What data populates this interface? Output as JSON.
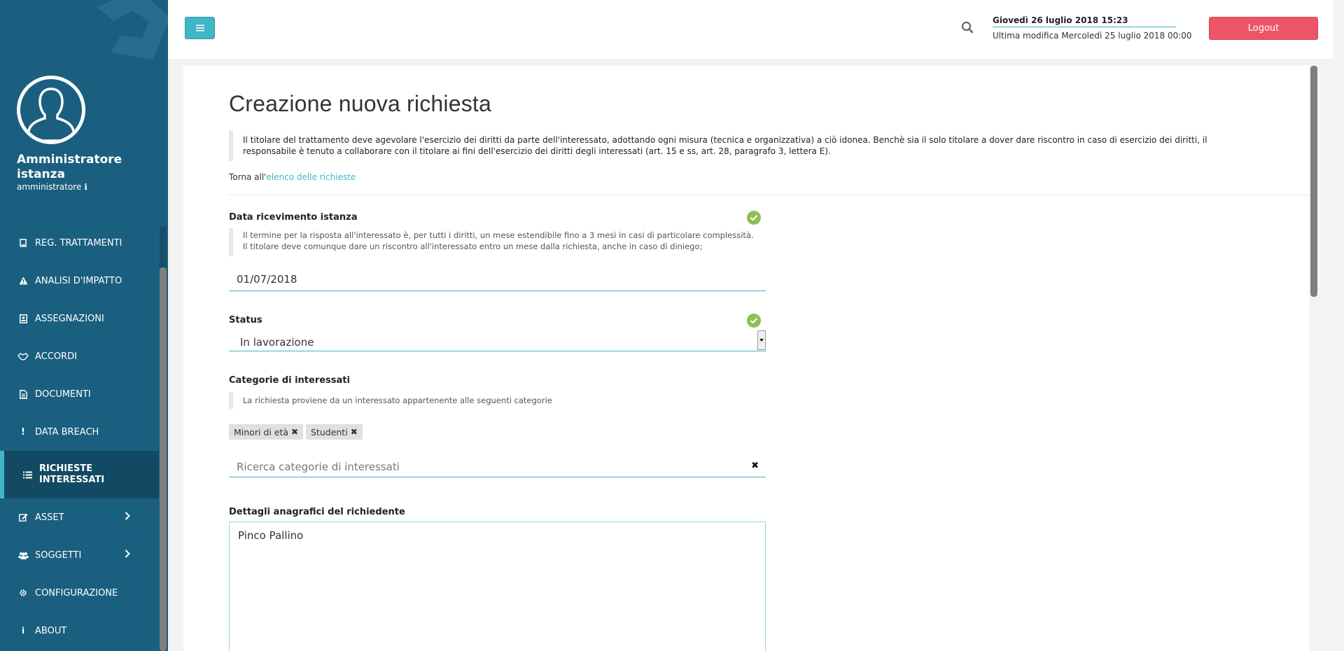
{
  "sidebar": {
    "user_name": "Amministratore istanza",
    "user_role": "amministratore",
    "items": [
      {
        "label": "REG. TRATTAMENTI",
        "icon": "book-icon"
      },
      {
        "label": "ANALISI D'IMPATTO",
        "icon": "warning-icon"
      },
      {
        "label": "ASSEGNAZIONI",
        "icon": "badge-icon"
      },
      {
        "label": "ACCORDI",
        "icon": "handshake-icon"
      },
      {
        "label": "DOCUMENTI",
        "icon": "document-icon"
      },
      {
        "label": "DATA BREACH",
        "icon": "exclamation-icon"
      },
      {
        "label": "RICHIESTE INTERESSATI",
        "icon": "list-icon",
        "active": true
      },
      {
        "label": "ASSET",
        "icon": "edit-icon",
        "has_submenu": true
      },
      {
        "label": "SOGGETTI",
        "icon": "users-icon",
        "has_submenu": true
      },
      {
        "label": "CONFIGURAZIONE",
        "icon": "gear-icon"
      },
      {
        "label": "ABOUT",
        "icon": "info-icon"
      }
    ]
  },
  "header": {
    "date_now": "Giovedì 26 luglio 2018 15:23",
    "last_modified": "Ultima modifica Mercoledì 25 luglio 2018 00:00",
    "logout_label": "Logout"
  },
  "main": {
    "title": "Creazione nuova richiesta",
    "intro": "Il titolare del trattamento deve agevolare l'esercizio dei diritti da parte dell'interessato, adottando ogni misura (tecnica e organizzativa) a ciò idonea. Benchè sia il solo titolare a dover dare riscontro in caso di esercizio dei diritti, il responsabile è tenuto a collaborare con il titolare ai fini dell'esercizio dei diritti degli interessati (art. 15 e ss, art. 28, paragrafo 3, lettera E).",
    "back_prefix": "Torna all'",
    "back_link": "elenco delle richieste",
    "fields": {
      "data_ricevimento": {
        "label": "Data ricevimento istanza",
        "help": "Il termine per la risposta all'interessato è, per tutti i diritti, un mese estendibile fino a 3 mesi in casi di particolare complessità. Il titolare deve comunque dare un riscontro all'interessato entro un mese dalla richiesta, anche in caso di diniego;",
        "value": "01/07/2018"
      },
      "status": {
        "label": "Status",
        "value": "In lavorazione"
      },
      "categorie": {
        "label": "Categorie di interessati",
        "help": "La richiesta proviene da un interessato appartenente alle seguenti categorie",
        "tags": [
          "Minori di età",
          "Studenti"
        ],
        "placeholder": "Ricerca categorie di interessati"
      },
      "dettagli": {
        "label": "Dettagli anagrafici del richiedente",
        "value": "Pinco Pallino"
      }
    }
  },
  "colors": {
    "sidebar": "#1a5f7f",
    "accent": "#3fb6c6",
    "logout": "#ec5565",
    "success": "#8cc152"
  }
}
